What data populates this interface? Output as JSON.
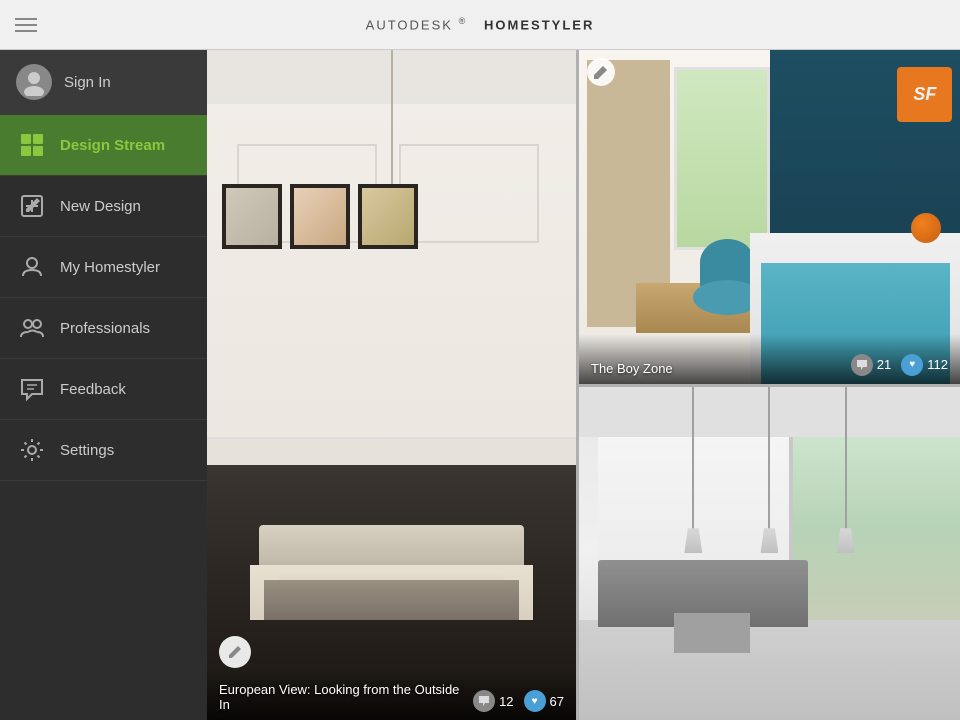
{
  "header": {
    "title_brand": "AUTODESK",
    "title_app": "HOMESTYLER",
    "title_trademark": "®",
    "menu_icon_label": "Menu"
  },
  "sidebar": {
    "signin_label": "Sign In",
    "items": [
      {
        "id": "design-stream",
        "label": "Design Stream",
        "active": true
      },
      {
        "id": "new-design",
        "label": "New Design",
        "active": false
      },
      {
        "id": "my-homestyler",
        "label": "My Homestyler",
        "active": false
      },
      {
        "id": "professionals",
        "label": "Professionals",
        "active": false
      },
      {
        "id": "feedback",
        "label": "Feedback",
        "active": false
      },
      {
        "id": "settings",
        "label": "Settings",
        "active": false
      }
    ]
  },
  "cards": {
    "large": {
      "title": "European View: Looking from the Outside In",
      "comments": "12",
      "likes": "67",
      "edit_badge": "✎"
    },
    "top_right": {
      "title": "The Boy Zone",
      "comments": "21",
      "likes": "112",
      "edit_badge": "✎"
    },
    "bottom_right": {
      "title": "",
      "comments": "",
      "likes": ""
    }
  },
  "icons": {
    "menu": "☰",
    "chat_bubble": "💬",
    "heart": "♥",
    "edit": "✎",
    "sf_text": "SF"
  }
}
